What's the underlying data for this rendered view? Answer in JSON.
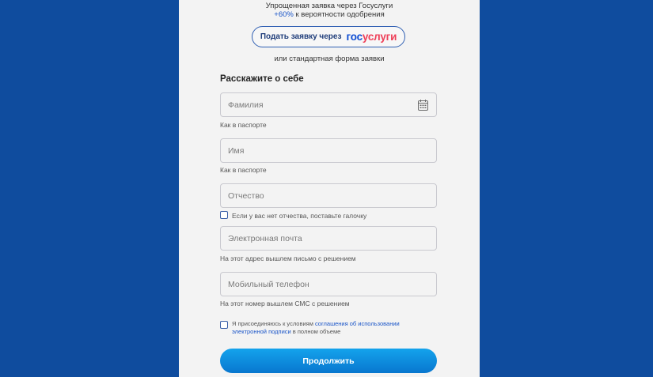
{
  "promo": {
    "line1": "Упрощенная заявка через Госуслуги",
    "accent": "+60%",
    "line2_rest": " к вероятности одобрения"
  },
  "gosuslugi_button": {
    "label": "Подать заявку через",
    "logo_part1": "гос",
    "logo_part2": "услуги"
  },
  "alt_form_text": "или стандартная форма заявки",
  "form": {
    "title": "Расскажите о себе",
    "surname": {
      "placeholder": "Фамилия",
      "hint": "Как в паспорте",
      "icon": "calendar-icon"
    },
    "name": {
      "placeholder": "Имя",
      "hint": "Как в паспорте"
    },
    "patronymic": {
      "placeholder": "Отчество"
    },
    "no_patronymic_checkbox": {
      "label": "Если у вас нет отчества, поставьте галочку",
      "checked": false
    },
    "email": {
      "placeholder": "Электронная почта",
      "hint": "На этот адрес вышлем письмо с решением"
    },
    "phone": {
      "placeholder": "Мобильный телефон",
      "hint": "На этот номер вышлем СМС с решением"
    },
    "consent": {
      "checked": false,
      "prefix": "Я присоединяюсь к условиям ",
      "link": "соглашения об использовании электронной подписи",
      "suffix": " в полном объеме"
    },
    "submit_label": "Продолжить"
  },
  "colors": {
    "page_background": "#0f4c9e",
    "card_background": "#f3f3f3",
    "accent_blue": "#1a55c8",
    "gos_blue": "#0d4cd3",
    "gos_red": "#ee3f58",
    "button_gradient_top": "#14a3ec",
    "button_gradient_bottom": "#0877cf"
  }
}
